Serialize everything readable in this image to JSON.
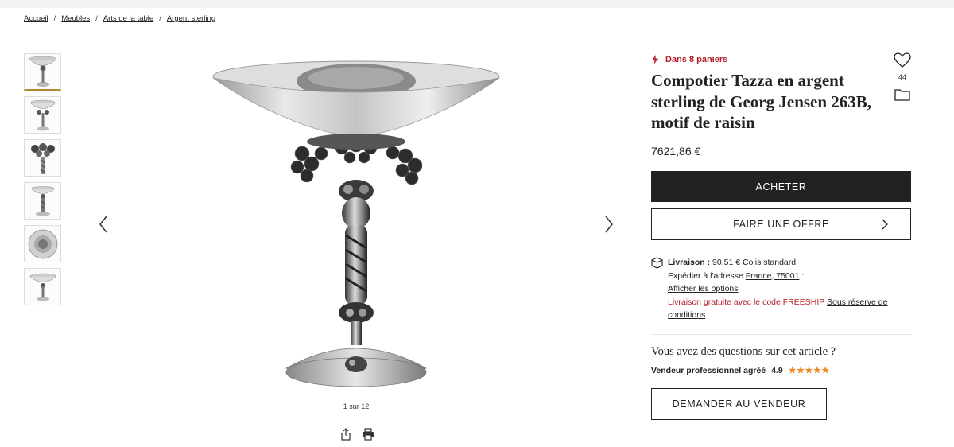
{
  "breadcrumb": [
    {
      "label": "Accueil"
    },
    {
      "label": "Meubles"
    },
    {
      "label": "Arts de la table"
    },
    {
      "label": "Argent sterling"
    }
  ],
  "gallery": {
    "thumbnail_count": 6,
    "counter": "1 sur 12"
  },
  "product": {
    "hot_label": "Dans 8 paniers",
    "title": "Compotier Tazza en argent sterling de Georg Jensen 263B, motif de raisin",
    "favorites_count": "44",
    "price": "7621,86 €"
  },
  "actions": {
    "buy_label": "ACHETER",
    "offer_label": "FAIRE UNE OFFRE",
    "ask_label": "DEMANDER AU VENDEUR"
  },
  "delivery": {
    "label": "Livraison :",
    "cost": "90,51 € Colis standard",
    "ship_to_prefix": "Expédier à l'adresse",
    "ship_to_link": "France, 75001",
    "ship_to_suffix": ":",
    "options_link": "Afficher les options",
    "free_text": "Livraison gratuite avec le code FREESHIP",
    "conditions_link": "Sous réserve de conditions"
  },
  "questions": {
    "heading": "Vous avez des questions sur cet article ?",
    "seller_label": "Vendeur professionnel agréé",
    "rating": "4.9",
    "stars": "★★★★★"
  },
  "colors": {
    "accent_red": "#b3202a",
    "star_orange": "#f08a24",
    "button_dark": "#222222"
  },
  "icons": {
    "hot": "lightning-icon",
    "favorite": "heart-icon",
    "folder": "folder-icon",
    "delivery": "package-icon",
    "share": "share-icon",
    "print": "printer-icon",
    "prev": "chevron-left-icon",
    "next": "chevron-right-icon"
  }
}
